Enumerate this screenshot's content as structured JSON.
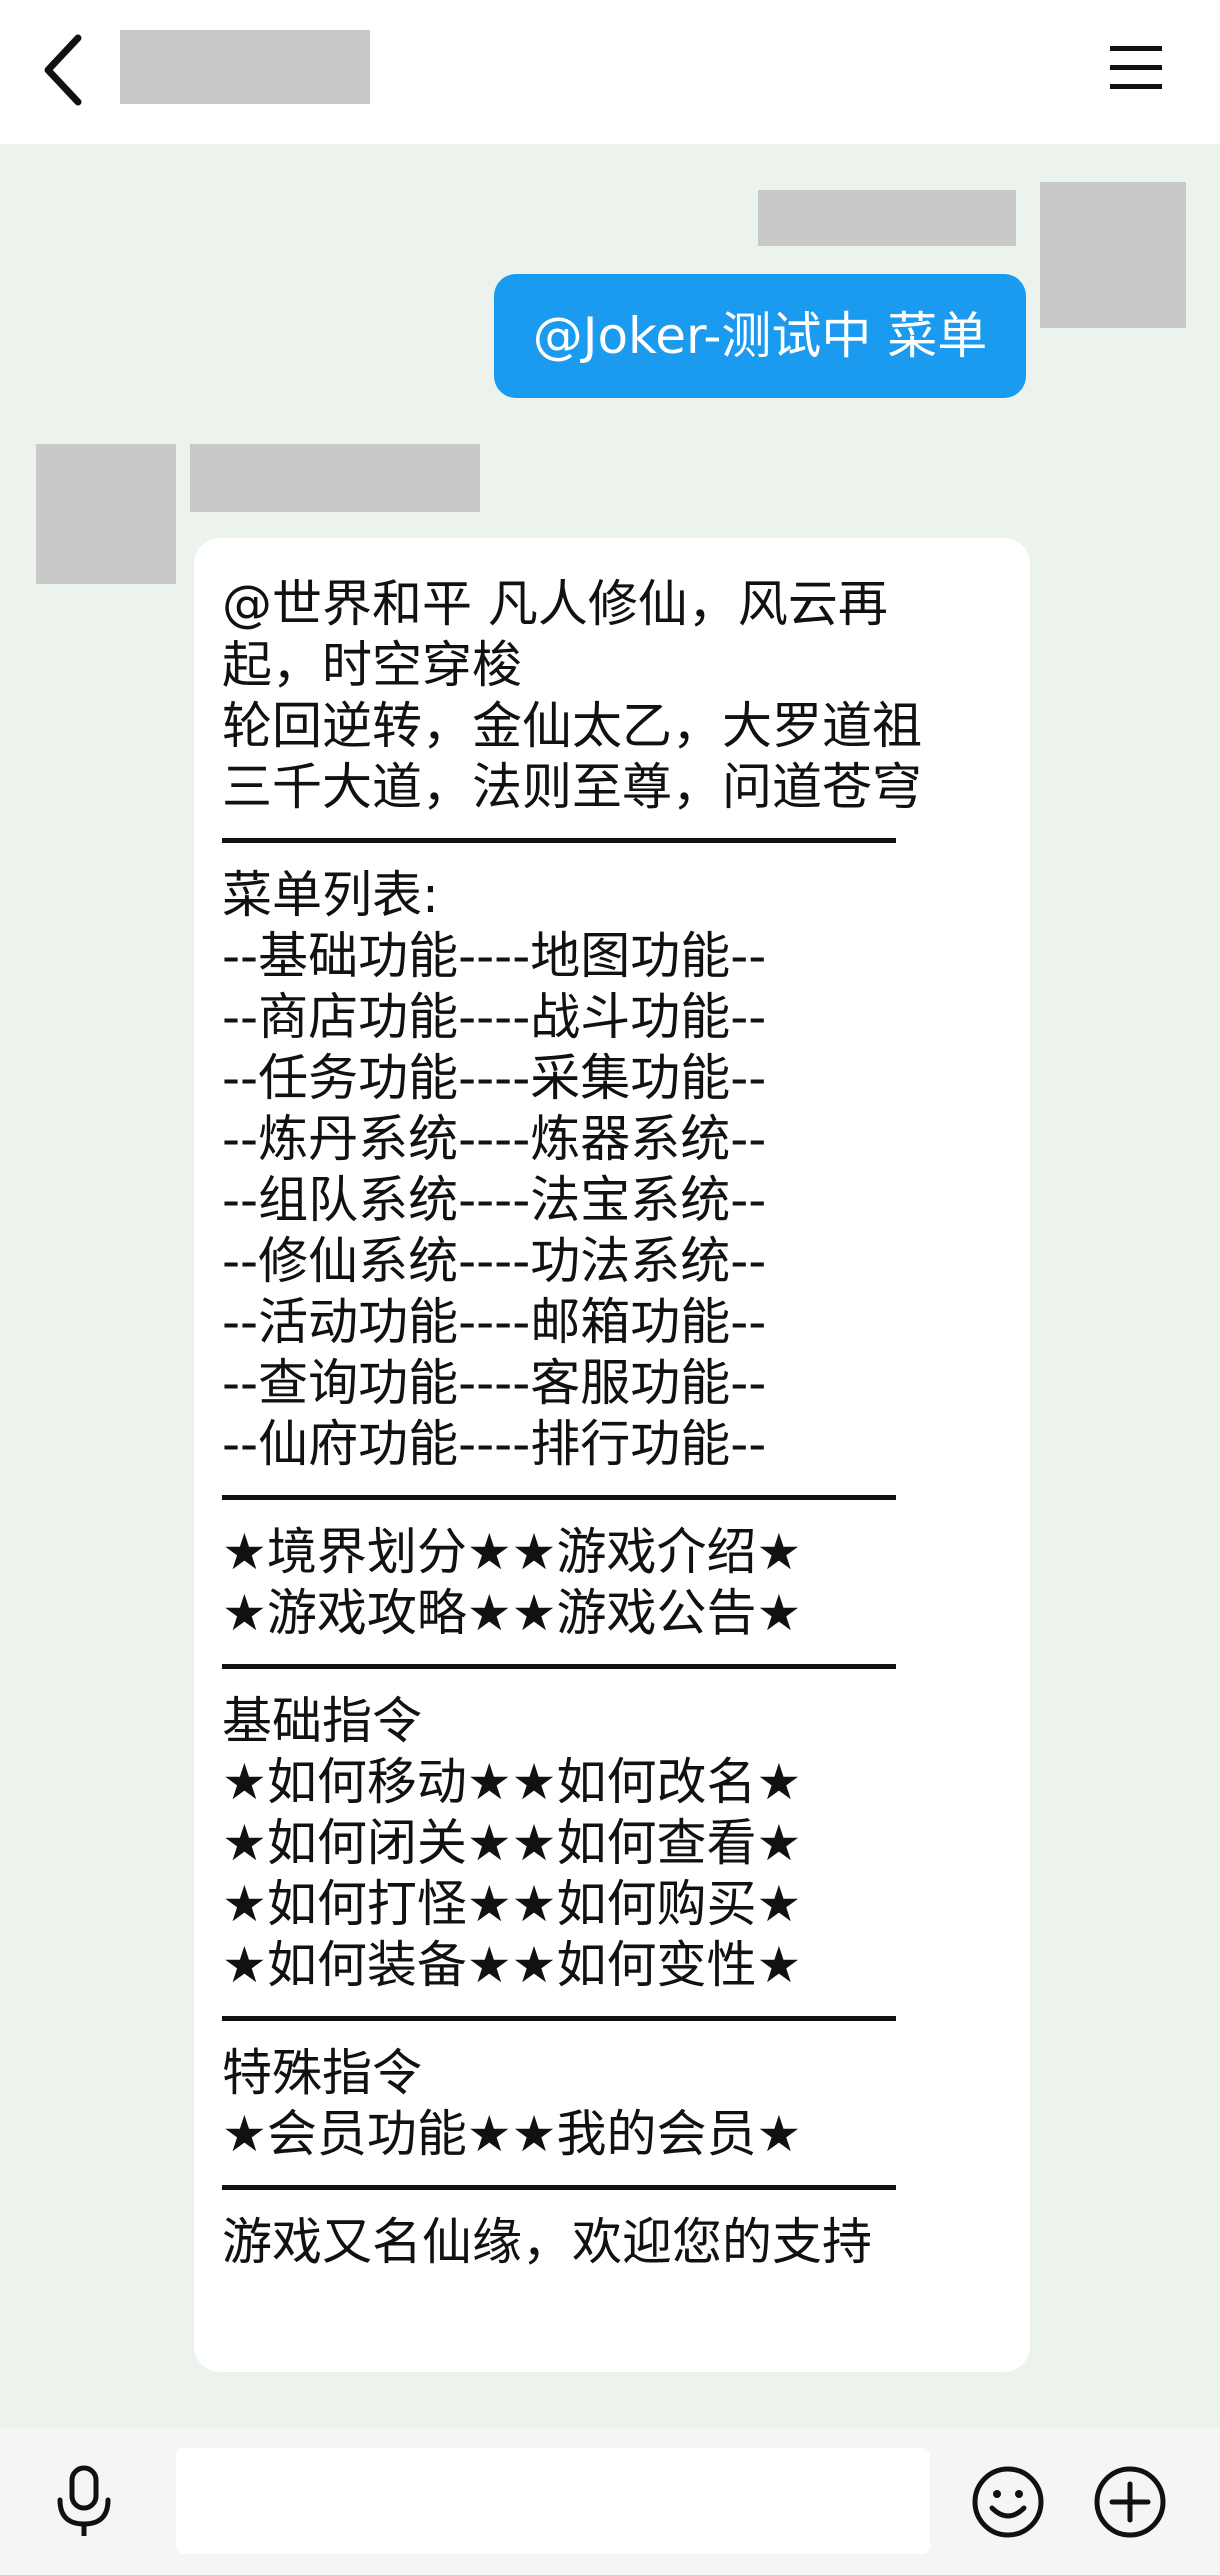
{
  "header": {
    "back_icon": "chevron-left-icon",
    "menu_icon": "hamburger-menu-icon"
  },
  "messages": [
    {
      "direction": "outgoing",
      "text": "@Joker-测试中 菜单"
    },
    {
      "direction": "incoming",
      "intro_lines": [
        "@世界和平 凡人修仙，风云再起，时空穿梭",
        "轮回逆转，金仙太乙，大罗道祖",
        "三千大道，法则至尊，问道苍穹"
      ],
      "menu_title": "菜单列表:",
      "menu_lines": [
        "--基础功能----地图功能--",
        "--商店功能----战斗功能--",
        "--任务功能----采集功能--",
        "--炼丹系统----炼器系统--",
        "--组队系统----法宝系统--",
        "--修仙系统----功法系统--",
        "--活动功能----邮箱功能--",
        "--查询功能----客服功能--",
        "--仙府功能----排行功能--"
      ],
      "info_lines": [
        "★境界划分★★游戏介绍★",
        "★游戏攻略★★游戏公告★"
      ],
      "basic_title": "基础指令",
      "basic_lines": [
        "★如何移动★★如何改名★",
        "★如何闭关★★如何查看★",
        "★如何打怪★★如何购买★",
        "★如何装备★★如何变性★"
      ],
      "special_title": "特殊指令",
      "special_lines": [
        "★会员功能★★我的会员★"
      ],
      "closing": "游戏又名仙缘，欢迎您的支持"
    }
  ],
  "footer": {
    "input_value": "",
    "voice_icon": "microphone-icon",
    "emoji_icon": "smiley-icon",
    "plus_icon": "plus-circle-icon"
  },
  "colors": {
    "chat_background": "#ebf3ec",
    "outgoing_bubble": "#1a9bf0",
    "incoming_bubble": "#ffffff",
    "redacted_block": "#c9c9c9"
  }
}
